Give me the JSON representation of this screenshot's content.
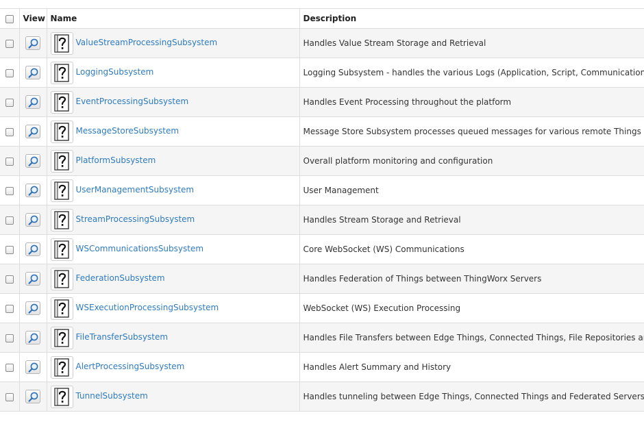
{
  "header": {
    "view_label": "View",
    "name_label": "Name",
    "description_label": "Description"
  },
  "rows": [
    {
      "name": "ValueStreamProcessingSubsystem",
      "description": "Handles Value Stream Storage and Retrieval"
    },
    {
      "name": "LoggingSubsystem",
      "description": "Logging Subsystem - handles the various Logs (Application, Script, Communications, etc.)"
    },
    {
      "name": "EventProcessingSubsystem",
      "description": "Handles Event Processing throughout the platform"
    },
    {
      "name": "MessageStoreSubsystem",
      "description": "Message Store Subsystem processes queued messages for various remote Things including Edge"
    },
    {
      "name": "PlatformSubsystem",
      "description": "Overall platform monitoring and configuration"
    },
    {
      "name": "UserManagementSubsystem",
      "description": "User Management"
    },
    {
      "name": "StreamProcessingSubsystem",
      "description": "Handles Stream Storage and Retrieval"
    },
    {
      "name": "WSCommunicationsSubsystem",
      "description": "Core WebSocket (WS) Communications"
    },
    {
      "name": "FederationSubsystem",
      "description": "Handles Federation of Things between ThingWorx Servers"
    },
    {
      "name": "WSExecutionProcessingSubsystem",
      "description": "WebSocket (WS) Execution Processing"
    },
    {
      "name": "FileTransferSubsystem",
      "description": "Handles File Transfers between Edge Things, Connected Things, File Repositories and Federated"
    },
    {
      "name": "AlertProcessingSubsystem",
      "description": "Handles Alert Summary and History"
    },
    {
      "name": "TunnelSubsystem",
      "description": "Handles tunneling between Edge Things, Connected Things and Federated Servers"
    }
  ],
  "icons": {
    "view": "magnifier-icon",
    "thing": "unknown-thing-icon"
  },
  "colors": {
    "link": "#2e7bbf",
    "row_alt": "#f5f5f5",
    "border": "#dddddd"
  }
}
